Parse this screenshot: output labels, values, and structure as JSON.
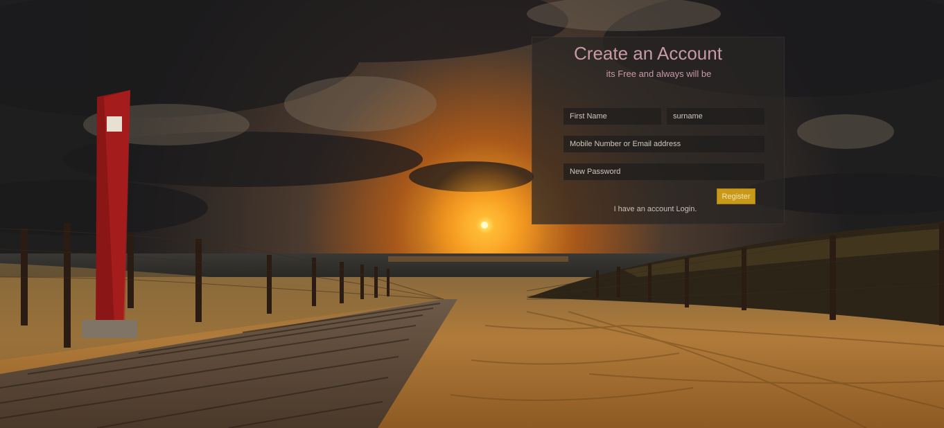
{
  "signup": {
    "title": "Create an Account",
    "subtitle": "its Free and always will be",
    "first_name_placeholder": "First Name",
    "surname_placeholder": "surname",
    "mobile_email_placeholder": "Mobile Number or Email address",
    "password_placeholder": "New Password",
    "register_label": "Register",
    "login_link": "I have an account Login."
  },
  "colors": {
    "title": "#c79aa6",
    "button": "#c99a19",
    "panel": "#282624"
  }
}
